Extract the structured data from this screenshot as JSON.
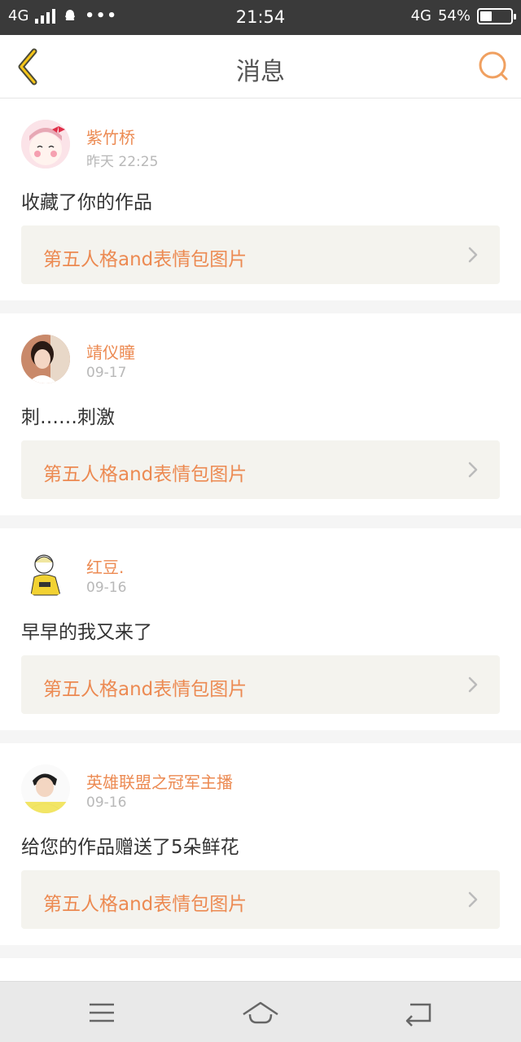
{
  "status_bar": {
    "network_left": "4G",
    "time": "21:54",
    "network_right": "4G",
    "battery": "54%"
  },
  "header": {
    "title": "消息",
    "back_icon": "back-chevron-icon",
    "search_icon": "search-icon"
  },
  "messages": [
    {
      "name": "紫竹桥",
      "time": "昨天 22:25",
      "text": "收藏了你的作品",
      "work": "第五人格and表情包图片"
    },
    {
      "name": "靖仪瞳",
      "time": "09-17",
      "text": "刺……刺激",
      "work": "第五人格and表情包图片"
    },
    {
      "name": "红豆.",
      "time": "09-16",
      "text": "早早的我又来了",
      "work": "第五人格and表情包图片"
    },
    {
      "name": "英雄联盟之冠军主播",
      "time": "09-16",
      "text": "给您的作品赠送了5朵鲜花",
      "work": "第五人格and表情包图片"
    }
  ],
  "colors": {
    "accent": "#ec8a52",
    "status_bar": "#3a3a3a",
    "link_bg": "#f4f3ee"
  },
  "nav": {
    "menu_icon": "menu-icon",
    "home_icon": "home-icon",
    "back_icon": "back-arrow-icon"
  }
}
